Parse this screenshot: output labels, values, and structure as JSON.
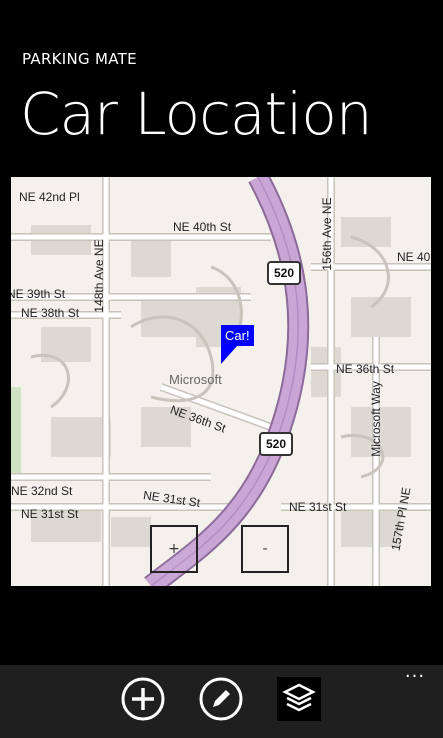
{
  "header": {
    "app_name": "PARKING MATE",
    "page_title": "Car Location"
  },
  "map": {
    "streets": {
      "ne_42nd_pl": "NE 42nd Pl",
      "ave_148": "148th Ave NE",
      "ne_40th": "NE 40th St",
      "ave_156": "156th Ave NE",
      "ne_40_right": "NE 40",
      "ne_39th": "NE 39th St",
      "ne_38th": "NE 38th St",
      "ne_36th_right": "NE 36th St",
      "ne_36th_mid": "NE 36th St",
      "microsoft_way": "Microsoft Way",
      "ne_32nd": "NE 32nd St",
      "ne_31st_left": "NE 31st St",
      "ne_31st_mid": "NE 31st St",
      "ne_31st_right": "NE 31st St",
      "ave_157_pl": "157th Pl NE"
    },
    "highway_shield_top": "520",
    "highway_shield_bottom": "520",
    "place_label": "Microsoft",
    "car_marker": "Car!",
    "zoom_in": "+",
    "zoom_out": "-"
  },
  "app_bar": {
    "buttons": [
      {
        "icon": "add-icon"
      },
      {
        "icon": "edit-icon"
      },
      {
        "icon": "layers-icon"
      }
    ],
    "more": "..."
  },
  "colors": {
    "background": "#000000",
    "highway": "#c39bd3",
    "marker": "#0000ff",
    "map_base": "#f4f1ec"
  }
}
